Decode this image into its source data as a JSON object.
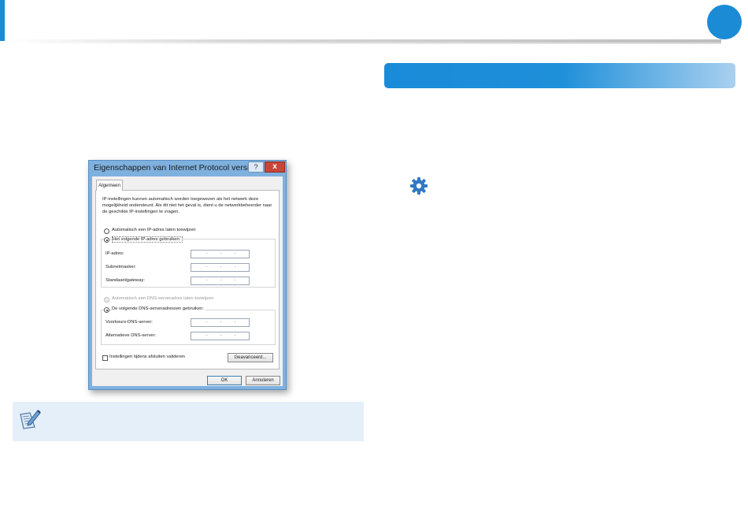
{
  "colors": {
    "accent": "#1b8bd6",
    "note_bg": "#e4eff9",
    "close": "#c7463a"
  },
  "icons": {
    "gear": "gear-icon",
    "note": "note-pencil-icon"
  },
  "dialog": {
    "title": "Eigenschappen van Internet Protocol versi...",
    "help_label": "?",
    "close_label": "x",
    "tab_label": "Algemeen",
    "description": "IP-instellingen kunnen automatisch worden toegewezen als het netwerk deze mogelijkheid ondersteunt. Als dit niet het geval is, dient u de netwerkbeheerder naar de geschikte IP-instellingen te vragen.",
    "ip_auto_label": "Automatisch een IP-adres laten toewijzen",
    "ip_manual_label": "Het volgende IP-adres gebruiken:",
    "ip_address_label": "IP-adres:",
    "subnet_label": "Subnetmasker:",
    "gateway_label": "Standaardgateway:",
    "dns_auto_label": "Automatisch een DNS-serveradres laten toewijzen",
    "dns_manual_label": "De volgende DNS-serveradressen gebruiken:",
    "preferred_dns_label": "Voorkeurs-DNS-server:",
    "alternate_dns_label": "Alternatieve DNS-server:",
    "ip_dot": ".",
    "validate_label": "Instellingen tijdens afsluiten valideren",
    "advanced_label": "Geavanceerd...",
    "ok_label": "OK",
    "cancel_label": "Annuleren"
  }
}
